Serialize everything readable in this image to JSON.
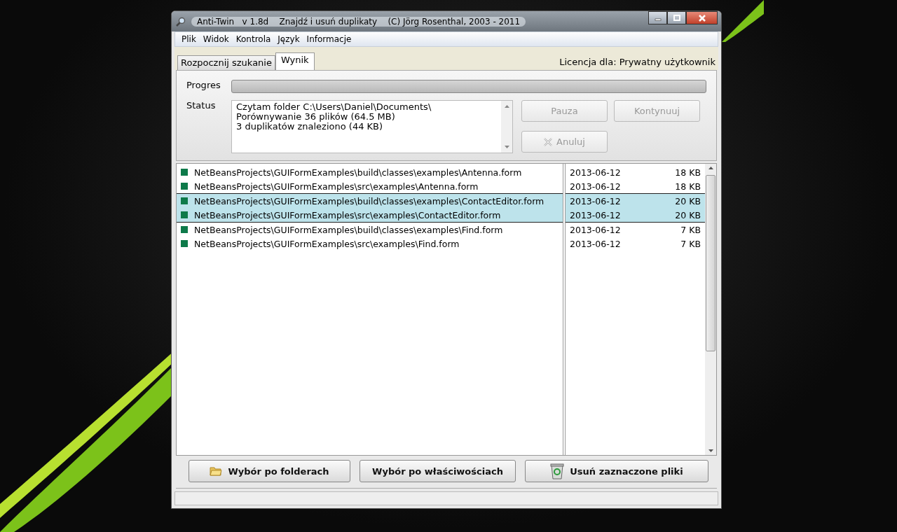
{
  "window": {
    "title": "Anti-Twin   v 1.8d    Znajdź i usuń duplikaty    (C) Jörg Rosenthal, 2003 - 2011"
  },
  "menu": [
    "Plik",
    "Widok",
    "Kontrola",
    "Język",
    "Informacje"
  ],
  "tabs": [
    {
      "label": "Rozpocznij szukanie",
      "selected": false
    },
    {
      "label": "Wynik",
      "selected": true
    }
  ],
  "license": "Licencja dla: Prywatny użytkownik",
  "progress": {
    "label": "Progres",
    "level": 0
  },
  "status": {
    "label": "Status",
    "lines": [
      "Czytam folder C:\\Users\\Daniel\\Documents\\",
      "Porównywanie 36 plików (64.5 MB)",
      "3 duplikatów znaleziono (44 KB)"
    ]
  },
  "control_buttons": [
    {
      "label": "Pauza",
      "disabled": true,
      "kind": "plain"
    },
    {
      "label": "Kontynuuj",
      "disabled": true,
      "kind": "plain"
    },
    {
      "label": "Anuluj",
      "disabled": true,
      "kind": "cancel"
    }
  ],
  "groups": [
    {
      "rows": [
        {
          "path": "NetBeansProjects\\GUIFormExamples\\build\\classes\\examples\\Antenna.form",
          "date": "2013-06-12",
          "size": "18 KB",
          "selected": false
        },
        {
          "path": "NetBeansProjects\\GUIFormExamples\\src\\examples\\Antenna.form",
          "date": "2013-06-12",
          "size": "18 KB",
          "selected": false
        }
      ]
    },
    {
      "rows": [
        {
          "path": "NetBeansProjects\\GUIFormExamples\\build\\classes\\examples\\ContactEditor.form",
          "date": "2013-06-12",
          "size": "20 KB",
          "selected": true
        },
        {
          "path": "NetBeansProjects\\GUIFormExamples\\src\\examples\\ContactEditor.form",
          "date": "2013-06-12",
          "size": "20 KB",
          "selected": true
        }
      ]
    },
    {
      "rows": [
        {
          "path": "NetBeansProjects\\GUIFormExamples\\build\\classes\\examples\\Find.form",
          "date": "2013-06-12",
          "size": "7 KB",
          "selected": false
        },
        {
          "path": "NetBeansProjects\\GUIFormExamples\\src\\examples\\Find.form",
          "date": "2013-06-12",
          "size": "7 KB",
          "selected": false
        }
      ]
    }
  ],
  "bottom_buttons": [
    {
      "label": "Wybór po folderach",
      "kind": "folder"
    },
    {
      "label": "Wybór po właściwościach",
      "kind": "plain"
    },
    {
      "label": "Usuń zaznaczone pliki",
      "kind": "recycle"
    }
  ]
}
